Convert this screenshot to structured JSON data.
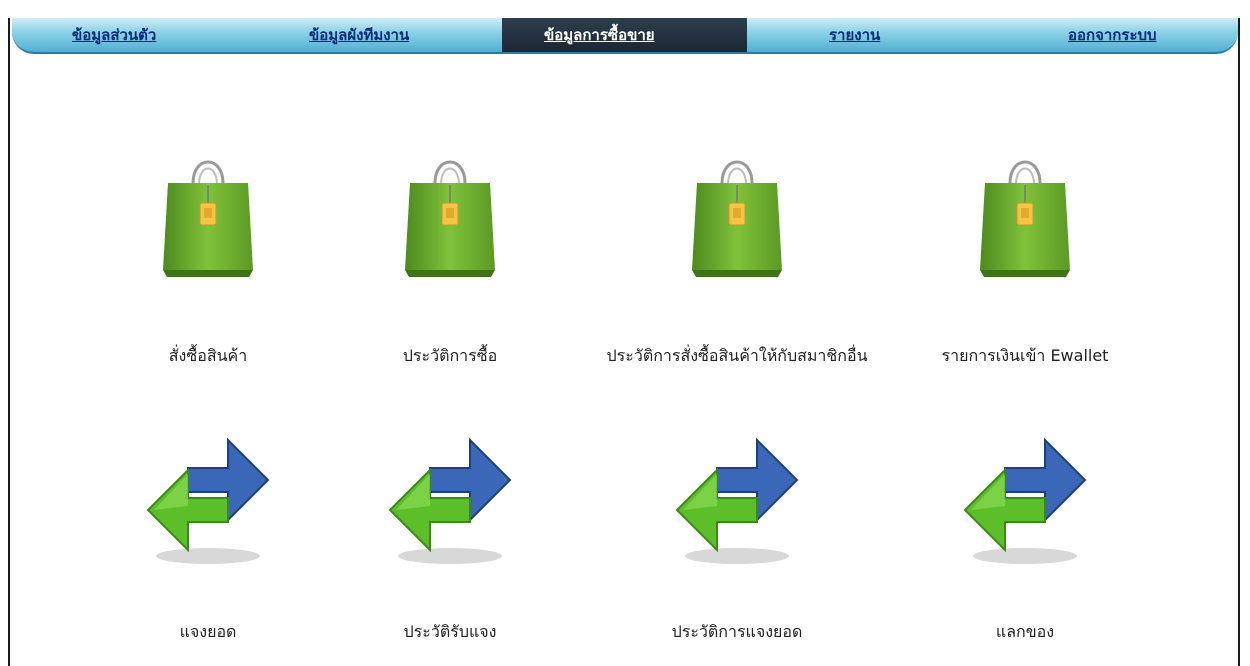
{
  "nav": {
    "items": [
      {
        "label": "ข้อมูลส่วนตัว",
        "active": false
      },
      {
        "label": "ข้อมูลผังทีมงาน",
        "active": false
      },
      {
        "label": "ข้อมูลการซื้อขาย",
        "active": true
      },
      {
        "label": "รายงาน",
        "active": false
      },
      {
        "label": "ออกจากระบบ",
        "active": false
      }
    ]
  },
  "tiles": {
    "row1": [
      {
        "label": "สั่งซื้อสินค้า",
        "icon": "shopping-bag-icon"
      },
      {
        "label": "ประวัติการซื้อ",
        "icon": "shopping-bag-icon"
      },
      {
        "label": "ประวัติการสั่งซื้อสินค้าให้กับสมาชิกอื่น",
        "icon": "shopping-bag-icon"
      },
      {
        "label": "รายการเงินเข้า Ewallet",
        "icon": "shopping-bag-icon"
      }
    ],
    "row2": [
      {
        "label": "แจงยอด",
        "icon": "exchange-arrows-icon"
      },
      {
        "label": "ประวัติรับแจง",
        "icon": "exchange-arrows-icon"
      },
      {
        "label": "ประวัติการแจงยอด",
        "icon": "exchange-arrows-icon"
      },
      {
        "label": "แลกของ",
        "icon": "exchange-arrows-icon"
      }
    ]
  },
  "colors": {
    "nav_text": "#0b2d78",
    "nav_active_bg": "#1f2b37",
    "bag_green": "#6cab2c",
    "arrow_blue": "#3a67b8",
    "arrow_green": "#5cbf2a"
  }
}
